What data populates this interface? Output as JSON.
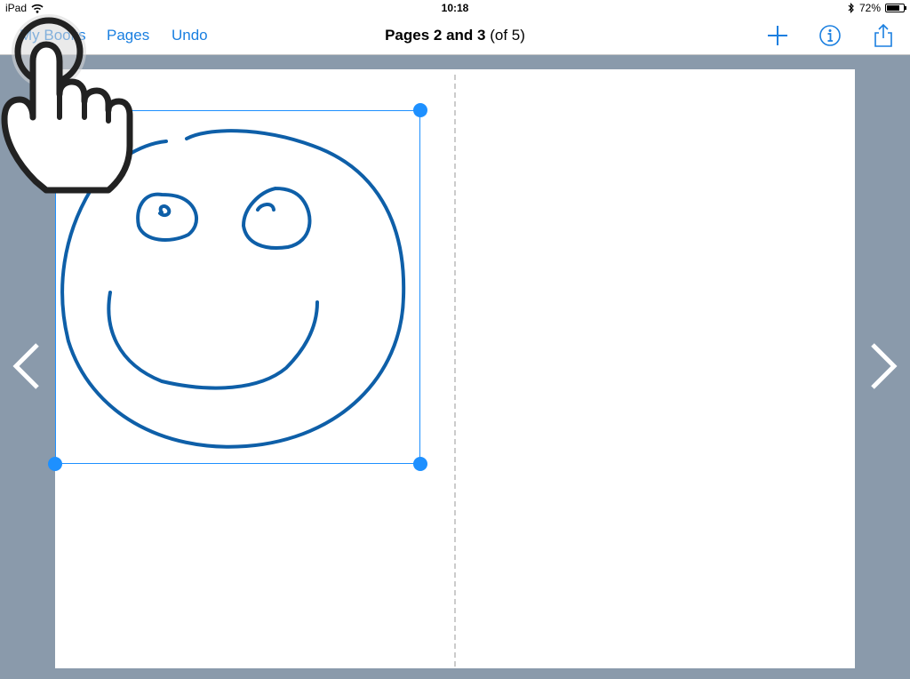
{
  "status": {
    "device": "iPad",
    "time": "10:18",
    "battery": "72%",
    "battery_level": 0.72
  },
  "nav": {
    "my_books": "My Books",
    "pages": "Pages",
    "undo": "Undo",
    "title_bold": "Pages 2 and 3",
    "title_rest": "(of 5)"
  },
  "icons": {
    "wifi": "wifi-icon",
    "bluetooth": "bluetooth-icon",
    "add": "plus-icon",
    "info": "info-icon",
    "share": "share-icon",
    "prev": "chevron-left-icon",
    "next": "chevron-right-icon",
    "hand": "tap-gesture-hand-icon"
  },
  "colors": {
    "accent": "#1a7fe0",
    "ink": "#0e5fa8",
    "selection": "#1e90ff",
    "background": "#8a9aab"
  }
}
